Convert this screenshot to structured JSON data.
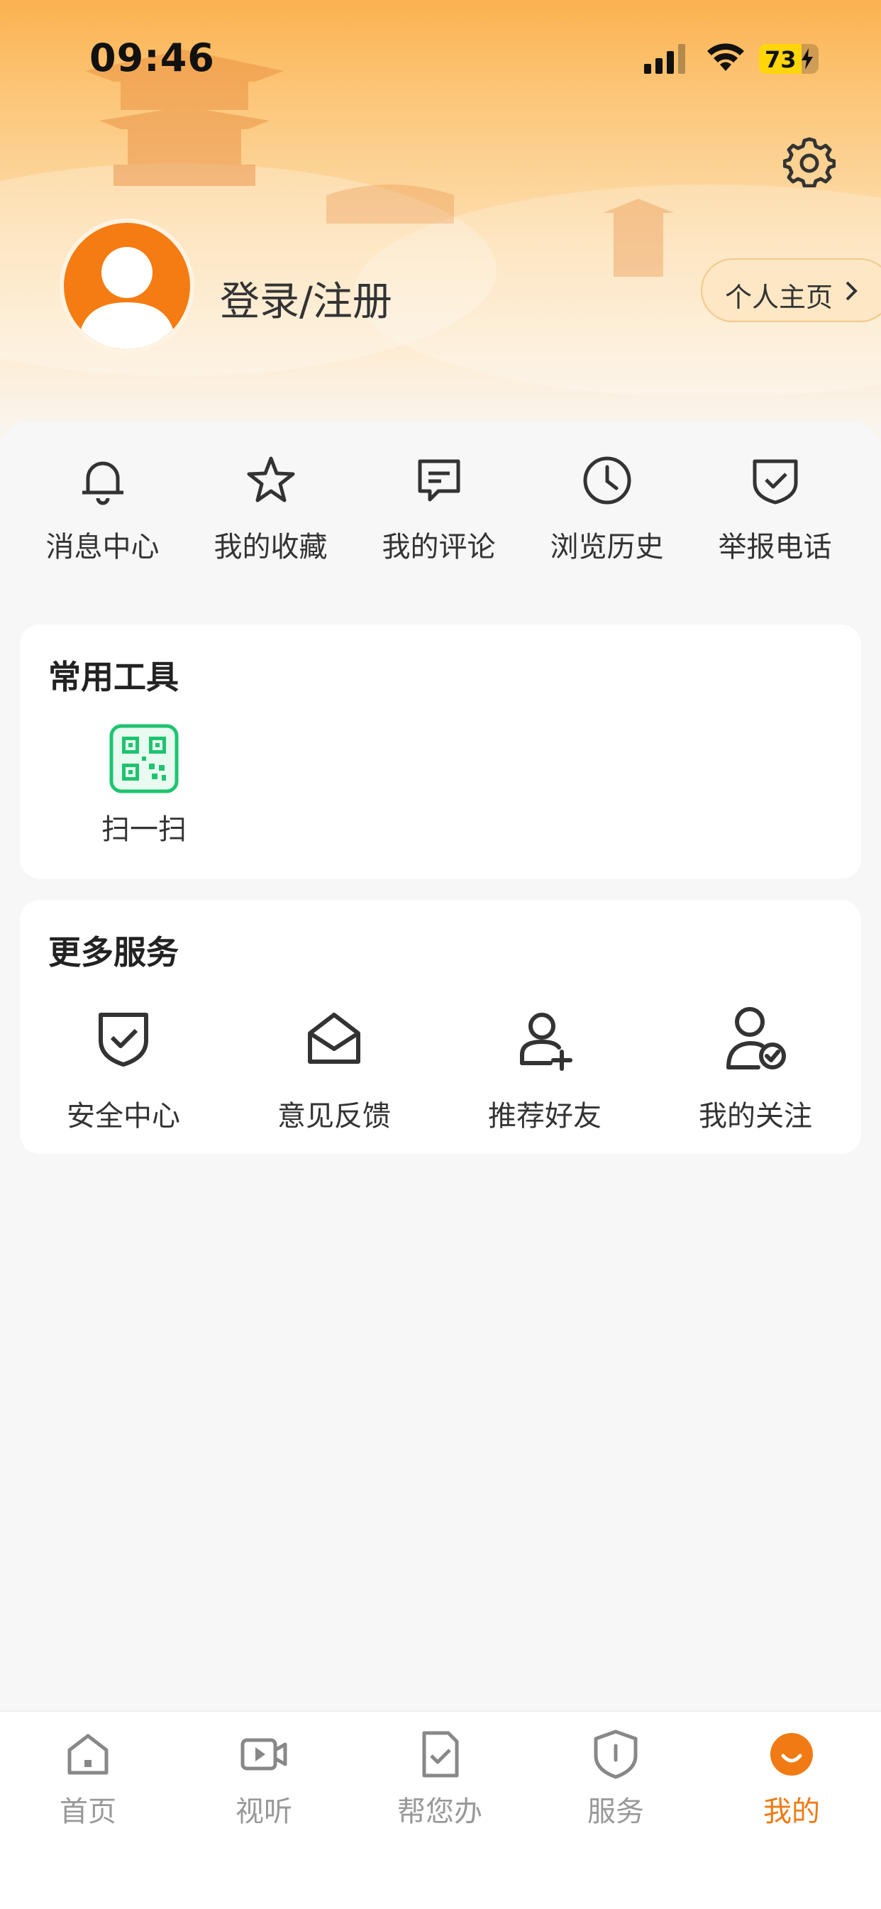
{
  "status_bar": {
    "time": "09:46",
    "battery_level": "73"
  },
  "profile": {
    "login_label": "登录/注册",
    "homepage_label": "个人主页"
  },
  "quick_actions": [
    {
      "label": "消息中心",
      "icon": "bell-icon"
    },
    {
      "label": "我的收藏",
      "icon": "star-icon"
    },
    {
      "label": "我的评论",
      "icon": "comment-icon"
    },
    {
      "label": "浏览历史",
      "icon": "clock-icon"
    },
    {
      "label": "举报电话",
      "icon": "shield-check-icon"
    }
  ],
  "tools_section": {
    "title": "常用工具",
    "items": [
      {
        "label": "扫一扫",
        "icon": "qr-code-icon"
      }
    ]
  },
  "services_section": {
    "title": "更多服务",
    "items": [
      {
        "label": "安全中心",
        "icon": "shield-check-icon"
      },
      {
        "label": "意见反馈",
        "icon": "open-envelope-icon"
      },
      {
        "label": "推荐好友",
        "icon": "add-user-icon"
      },
      {
        "label": "我的关注",
        "icon": "user-check-icon"
      }
    ]
  },
  "tabbar": {
    "items": [
      {
        "label": "首页",
        "icon": "home-icon",
        "active": false
      },
      {
        "label": "视听",
        "icon": "video-icon",
        "active": false
      },
      {
        "label": "帮您办",
        "icon": "doc-check-icon",
        "active": false
      },
      {
        "label": "服务",
        "icon": "shield-info-icon",
        "active": false
      },
      {
        "label": "我的",
        "icon": "smile-icon",
        "active": true
      }
    ]
  },
  "colors": {
    "accent": "#f07a13",
    "header_top": "#fbb24f",
    "background": "#f7f7f7"
  }
}
